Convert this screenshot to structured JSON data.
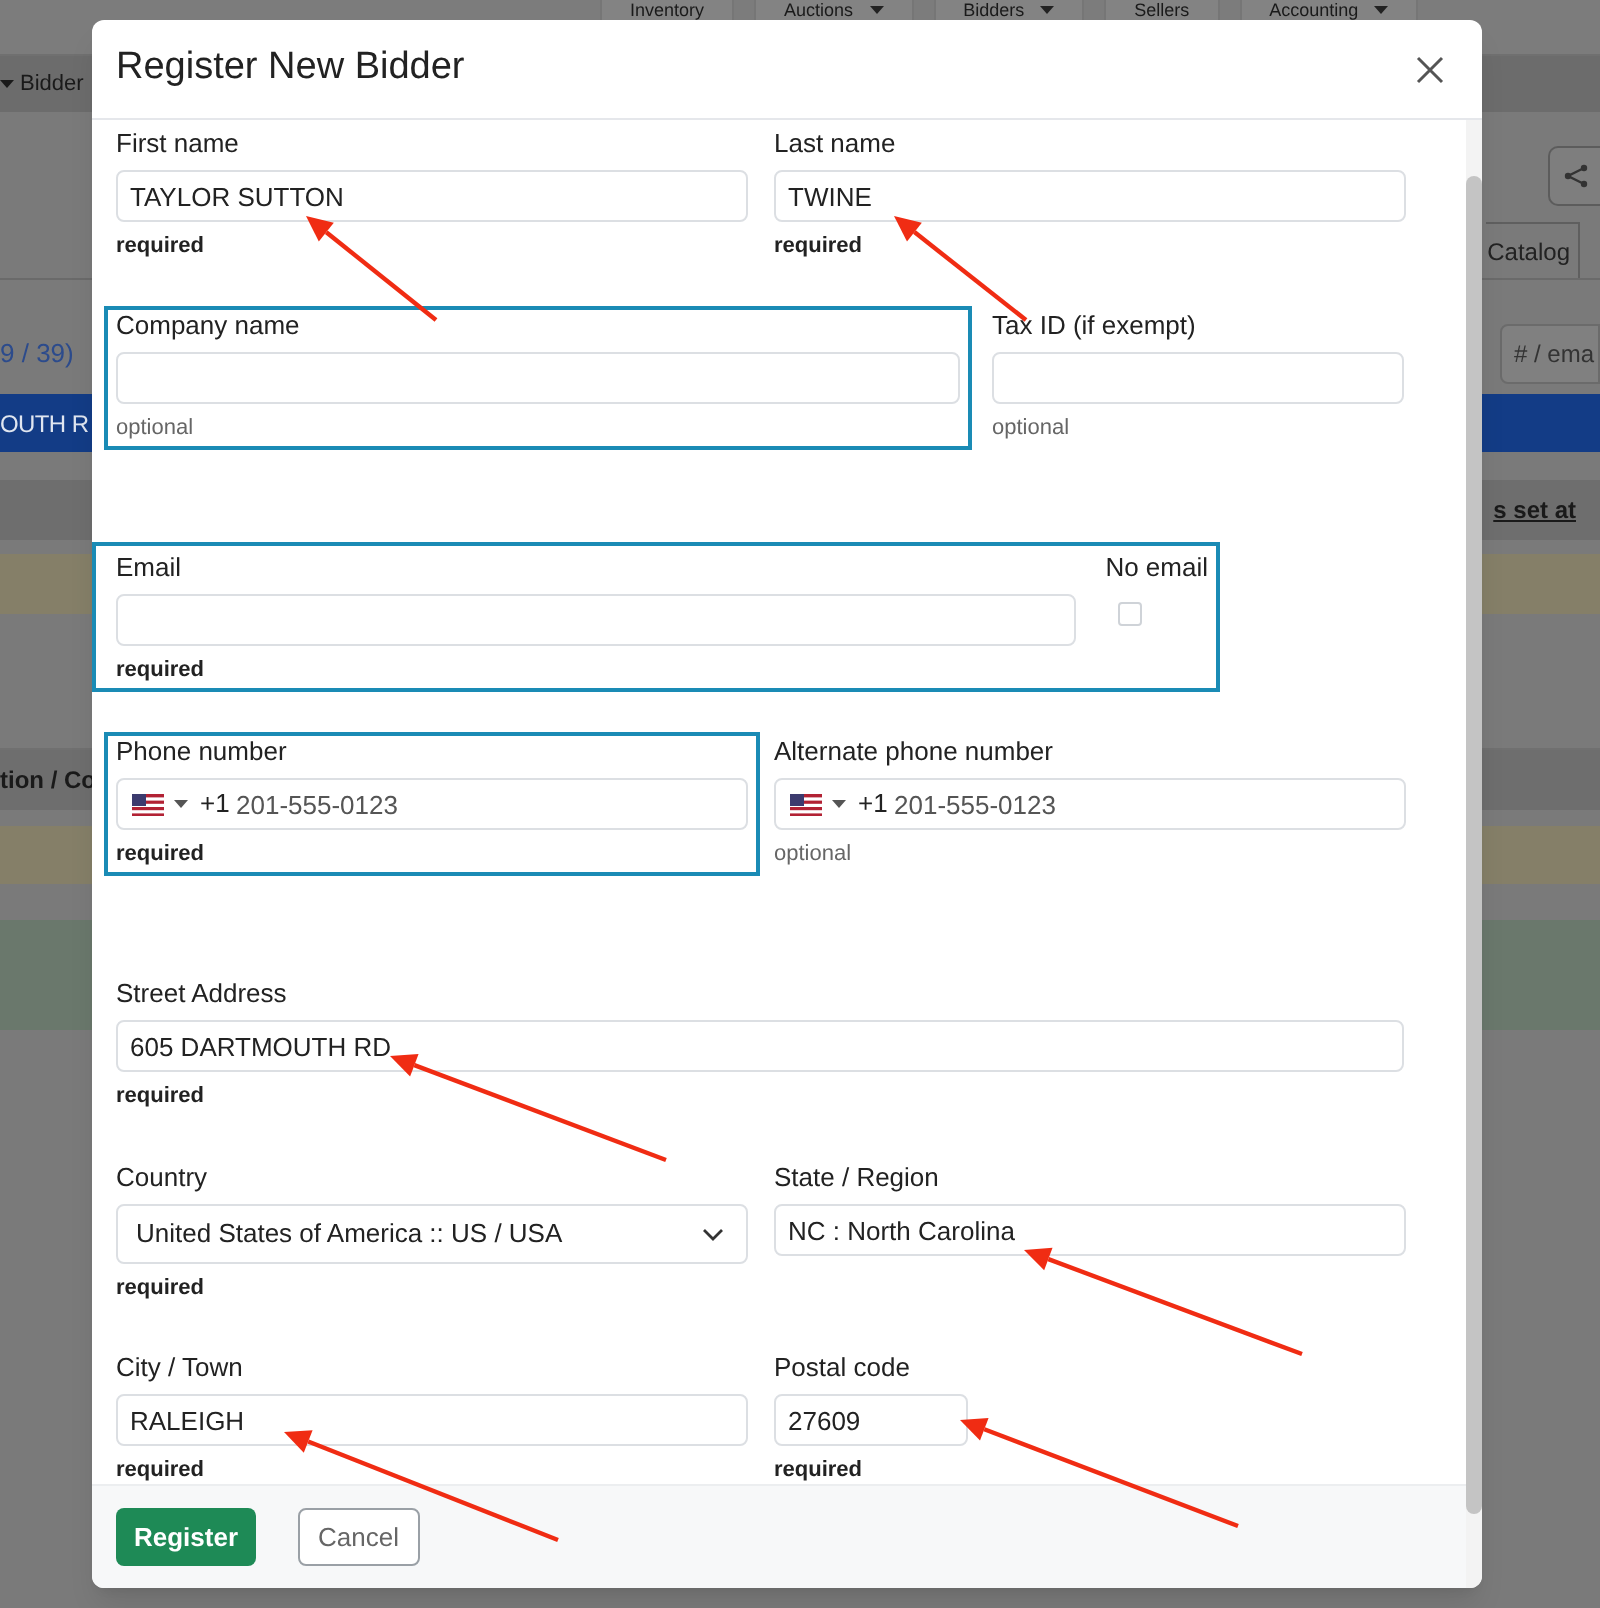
{
  "background": {
    "nav_items": [
      {
        "label": "Inventory",
        "dropdown": false
      },
      {
        "label": "Auctions",
        "dropdown": true
      },
      {
        "label": "Bidders",
        "dropdown": true
      },
      {
        "label": "Sellers",
        "dropdown": false
      },
      {
        "label": "Accounting",
        "dropdown": true
      }
    ],
    "breadcrumb": "Bidder",
    "tab": "Catalog",
    "count": "9 / 39)",
    "search_placeholder": "# / ema",
    "address_banner": "OUTH R",
    "column_link": "s set at",
    "column_heading": "tion / Co"
  },
  "dialog": {
    "title": "Register New Bidder",
    "rows": [
      {
        "fields": [
          {
            "kind": "text",
            "label": "First name",
            "value": "TAYLOR SUTTON",
            "note": "required",
            "required": true,
            "highlighted": false
          },
          {
            "kind": "text",
            "label": "Last name",
            "value": "TWINE",
            "note": "required",
            "required": true,
            "highlighted": false
          }
        ]
      },
      {
        "fields": [
          {
            "kind": "text",
            "label": "Company name",
            "note": "optional",
            "required": false,
            "highlighted": true
          },
          {
            "kind": "text",
            "label": "Tax ID (if exempt)",
            "note": "optional",
            "required": false,
            "highlighted": false
          }
        ]
      },
      {
        "fields": [
          {
            "kind": "email",
            "label": "Email",
            "note": "required",
            "required": true,
            "highlighted": true,
            "no_email": {
              "label": "No email",
              "checked": false
            }
          }
        ]
      },
      {
        "fields": [
          {
            "kind": "phone",
            "label": "Phone number",
            "dial_code": "+1",
            "placeholder": "201-555-0123",
            "note": "required",
            "required": true,
            "highlighted": true
          },
          {
            "kind": "phone",
            "label": "Alternate phone number",
            "dial_code": "+1",
            "placeholder": "201-555-0123",
            "note": "optional",
            "required": false,
            "highlighted": false
          }
        ]
      },
      {
        "fields": [
          {
            "kind": "text",
            "label": "Street Address",
            "value": "605 DARTMOUTH RD",
            "note": "required",
            "required": true,
            "highlighted": false
          }
        ]
      },
      {
        "fields": [
          {
            "kind": "select",
            "label": "Country",
            "value": "United States of America :: US / USA",
            "note": "required",
            "required": true,
            "highlighted": false
          },
          {
            "kind": "text",
            "label": "State / Region",
            "value": "NC : North Carolina",
            "highlighted": false
          }
        ]
      },
      {
        "fields": [
          {
            "kind": "text",
            "label": "City / Town",
            "value": "RALEIGH",
            "note": "required",
            "required": true,
            "highlighted": false
          },
          {
            "kind": "short",
            "label": "Postal code",
            "value": "27609",
            "note": "required",
            "required": true,
            "highlighted": false
          }
        ]
      }
    ],
    "buttons": [
      {
        "label": "Register",
        "kind": "primary"
      },
      {
        "label": "Cancel",
        "kind": "secondary"
      }
    ]
  }
}
